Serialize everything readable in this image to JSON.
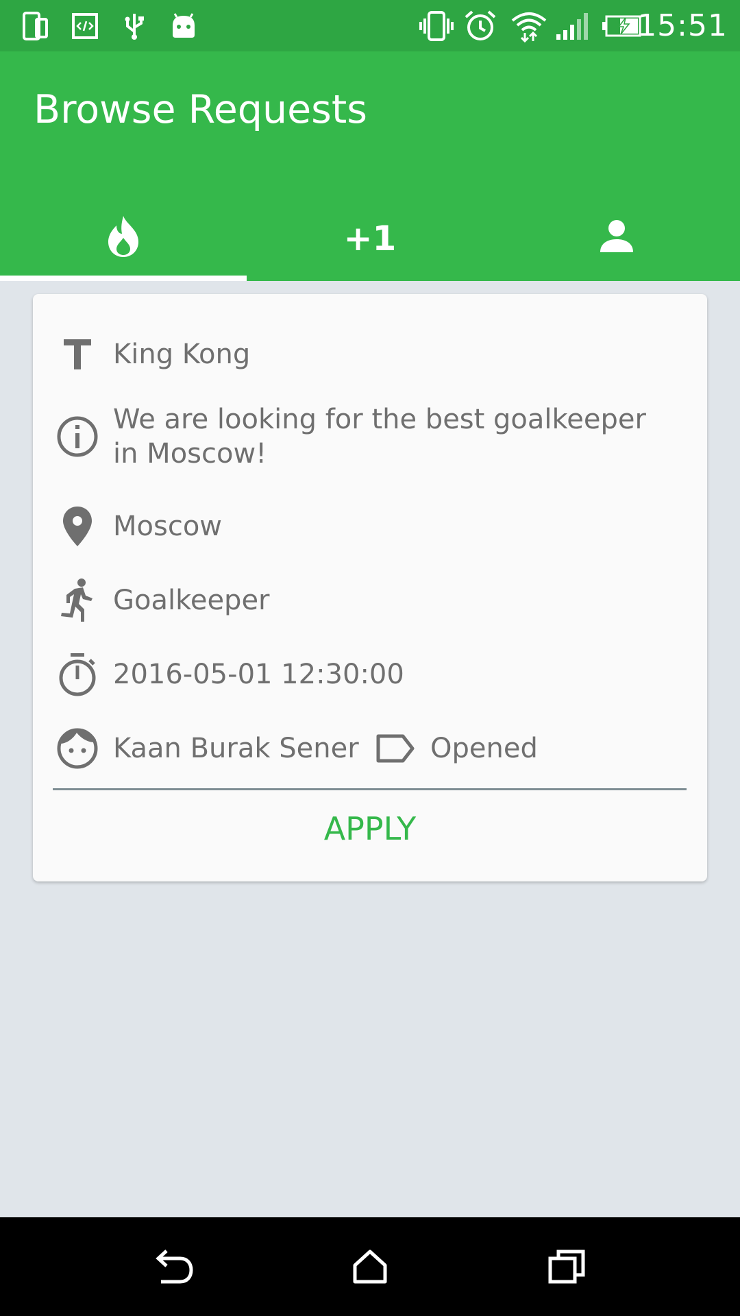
{
  "status_bar": {
    "time": "15:51",
    "left_icons": [
      "phone-outline-icon",
      "code-box-icon",
      "usb-icon",
      "android-icon"
    ],
    "right_icons": [
      "vibrate-icon",
      "alarm-icon",
      "wifi-icon",
      "signal-icon",
      "battery-charging-icon"
    ]
  },
  "app_bar": {
    "title": "Browse Requests",
    "tabs": [
      {
        "icon": "flame-icon",
        "label": "",
        "selected": true
      },
      {
        "icon": "",
        "label": "+1",
        "selected": false
      },
      {
        "icon": "person-icon",
        "label": "",
        "selected": false
      }
    ]
  },
  "card": {
    "title": "King Kong",
    "description": "We are looking for the best goalkeeper in Moscow!",
    "location": "Moscow",
    "position": "Goalkeeper",
    "datetime": "2016-05-01 12:30:00",
    "owner": "Kaan Burak Sener",
    "status": "Opened",
    "apply_label": "APPLY"
  },
  "colors": {
    "status_bar": "#2ea643",
    "primary": "#35b84b",
    "background": "#e0e5ea",
    "card": "#fafafa",
    "icon_grey": "#6f6f6f"
  },
  "nav_bar": {
    "buttons": [
      "back-icon",
      "home-icon",
      "recents-icon"
    ]
  }
}
